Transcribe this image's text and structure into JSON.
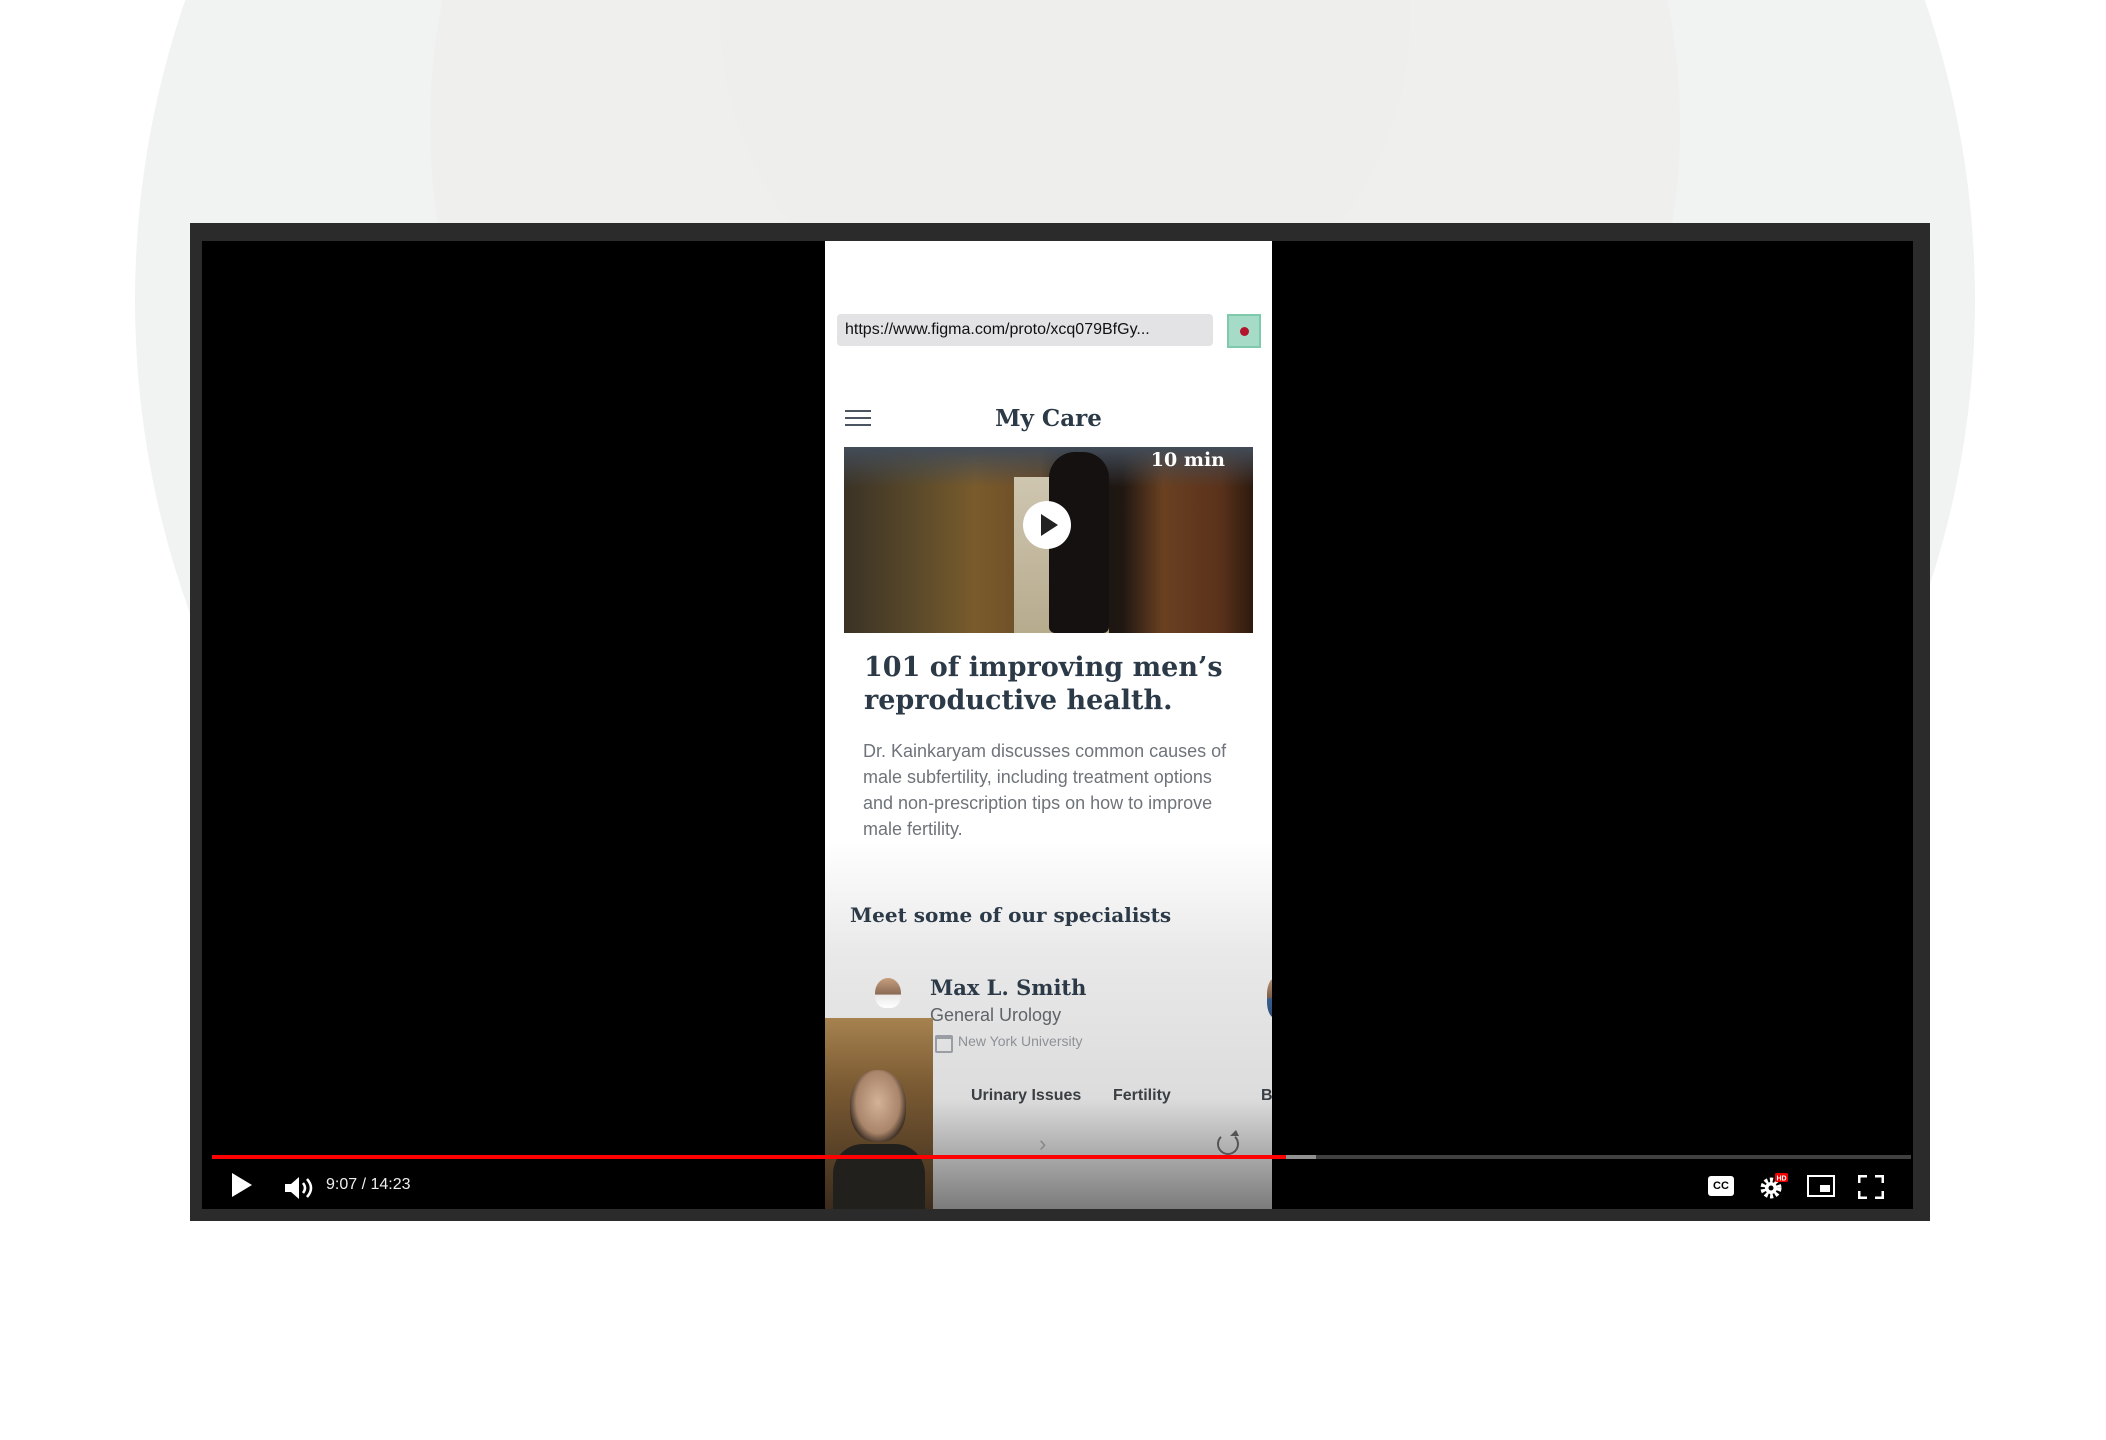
{
  "browser": {
    "url": "https://www.figma.com/proto/xcq079BfGy..."
  },
  "app": {
    "title": "My Care"
  },
  "featured_video": {
    "duration": "10 min",
    "title": "101 of improving men’s reproductive health.",
    "description": "Dr. Kainkaryam discusses common causes of male subfertility, including treatment options and non-prescription tips on how to improve male fertility."
  },
  "specialists": {
    "heading": "Meet some of our specialists",
    "doctor": {
      "name": "Max L. Smith",
      "specialty": "General Urology",
      "school": "New York University"
    },
    "tags": [
      "Urinary Issues",
      "Fertility",
      "B"
    ]
  },
  "player": {
    "time": "9:07 / 14:23",
    "progress": 0.632,
    "buffered": 0.65,
    "cc_label": "CC",
    "hd_badge": "HD",
    "accent": "#ff0000"
  }
}
